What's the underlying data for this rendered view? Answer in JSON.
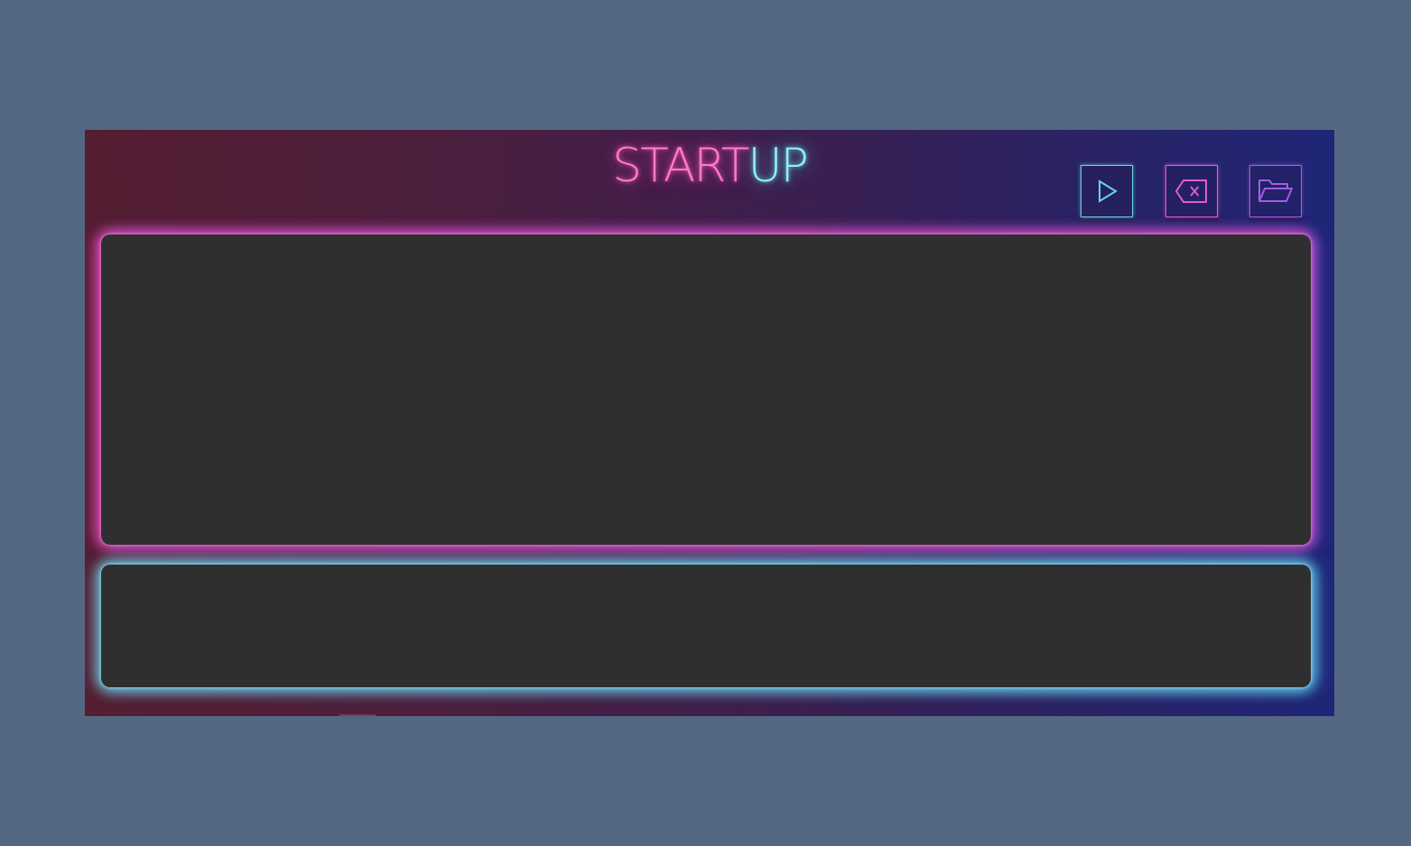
{
  "app": {
    "title_part_1": "START",
    "title_part_2": "UP"
  },
  "toolbar": {
    "run_button": {
      "icon": "play-icon",
      "color": "#66d6e6"
    },
    "clear_button": {
      "icon": "backspace-icon",
      "color": "#e45bd9"
    },
    "open_button": {
      "icon": "folder-open-icon",
      "color": "#a55be6"
    }
  },
  "editor": {
    "content": ""
  },
  "output": {
    "content": ""
  },
  "colors": {
    "page_background": "#536782",
    "panel_background": "#2f2f2f",
    "neon_pink": "#ff7ac8",
    "neon_cyan": "#8cf2f6",
    "gradient_left": "#551e32",
    "gradient_right": "#1f2677"
  }
}
